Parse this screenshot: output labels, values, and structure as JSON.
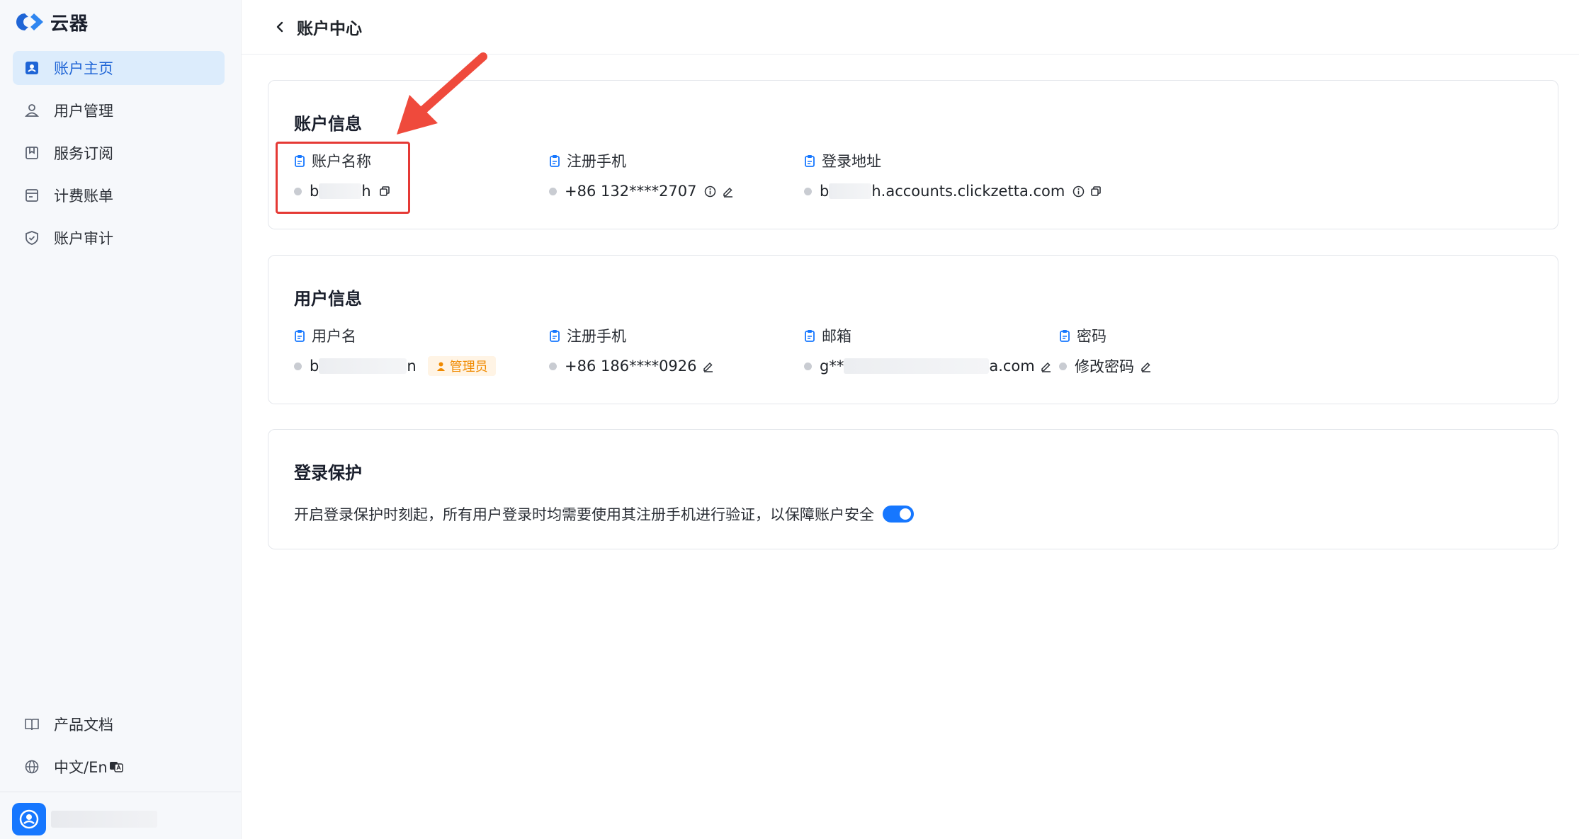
{
  "app": {
    "logo_text": "云器"
  },
  "sidebar": {
    "items": [
      {
        "label": "账户主页",
        "icon": "account-card-icon",
        "active": true
      },
      {
        "label": "用户管理",
        "icon": "user-icon"
      },
      {
        "label": "服务订阅",
        "icon": "bookmark-icon"
      },
      {
        "label": "计费账单",
        "icon": "bill-icon"
      },
      {
        "label": "账户审计",
        "icon": "shield-icon"
      }
    ],
    "bottom": [
      {
        "label": "产品文档",
        "icon": "book-icon"
      },
      {
        "label": "中文/En",
        "icon": "globe-icon"
      }
    ]
  },
  "header": {
    "title": "账户中心"
  },
  "account_info": {
    "title": "账户信息",
    "name_label": "账户名称",
    "name_prefix": "b",
    "name_suffix": "h",
    "phone_label": "注册手机",
    "phone_value": "+86 132****2707",
    "login_label": "登录地址",
    "login_prefix": "b",
    "login_suffix": "h.accounts.clickzetta.com"
  },
  "user_info": {
    "title": "用户信息",
    "username_label": "用户名",
    "username_prefix": "b",
    "username_suffix": "n",
    "role_badge": "管理员",
    "phone_label": "注册手机",
    "phone_value": "+86 186****0926",
    "email_label": "邮箱",
    "email_prefix": "g**",
    "email_suffix": "a.com",
    "password_label": "密码",
    "password_action": "修改密码"
  },
  "login_protection": {
    "title": "登录保护",
    "description": "开启登录保护时刻起，所有用户登录时均需要使用其注册手机进行验证，以保障账户安全",
    "enabled": true
  },
  "colors": {
    "accent": "#1677ff",
    "active_bg": "#dcecfc",
    "badge": "#f08a00",
    "annotation": "#e53935"
  }
}
